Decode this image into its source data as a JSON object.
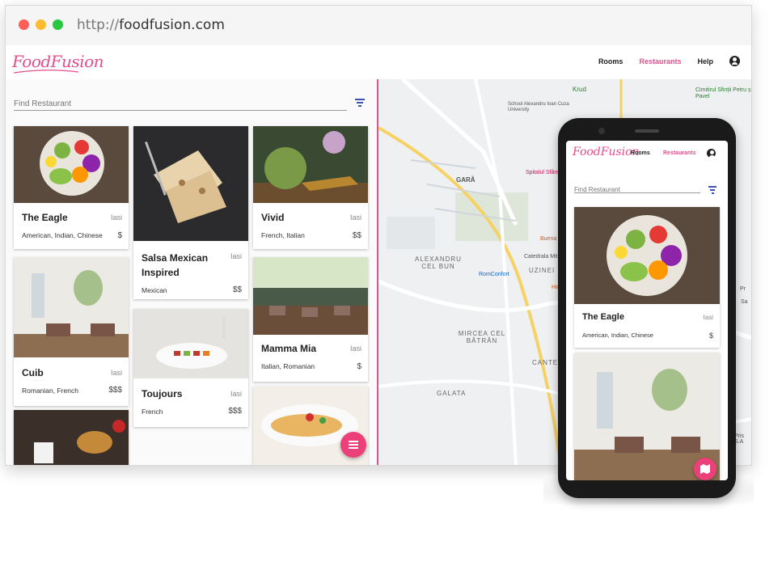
{
  "browser": {
    "url_protocol": "http://",
    "url_host": "foodfusion.com"
  },
  "app": {
    "logo_text": "FoodFusion",
    "nav": {
      "rooms": "Rooms",
      "restaurants": "Restaurants",
      "help": "Help"
    },
    "accent_color": "#e34f8c"
  },
  "search": {
    "placeholder": "Find Restaurant"
  },
  "restaurants": [
    {
      "name": "The Eagle",
      "city": "Iasi",
      "cuisine": "American, Indian, Chinese",
      "price": "$"
    },
    {
      "name": "Salsa Mexican Inspired",
      "city": "Iasi",
      "cuisine": "Mexican",
      "price": "$$"
    },
    {
      "name": "Vivid",
      "city": "Iasi",
      "cuisine": "French, Italian",
      "price": "$$"
    },
    {
      "name": "Cuib",
      "city": "Iasi",
      "cuisine": "Romanian, French",
      "price": "$$$"
    },
    {
      "name": "Toujours",
      "city": "Iasi",
      "cuisine": "French",
      "price": "$$$"
    },
    {
      "name": "Mamma Mia",
      "city": "Iasi",
      "cuisine": "Italian, Romanian",
      "price": "$"
    }
  ],
  "map_labels": {
    "krud": "Krud",
    "school": "School Alexandru Ioan Cuza University",
    "cimitir": "Cimitirul Sfinții Petru și Pavel",
    "gara": "GARĂ",
    "spitalul": "Spitalul Sfânt",
    "catedrala": "Catedrala Mitrop.",
    "uzinei": "UZINEI",
    "alexandru": "ALEXANDRU CEL BUN",
    "romconfort": "RomConfort",
    "mircea": "MIRCEA CEL BĂTRÂN",
    "cante": "CANTE",
    "galata": "GALATA",
    "buena": "Buena",
    "ha": "Ha",
    "pr": "Pr",
    "sa": "Sa",
    "prisa": "Pris S.A"
  },
  "phone": {
    "logo_text": "FoodFusion",
    "nav_rooms": "Rooms",
    "nav_restaurants": "Restaurants",
    "search_placeholder": "Find Restaurant",
    "card": {
      "name": "The Eagle",
      "city": "Iasi",
      "cuisine": "American, Indian, Chinese",
      "price": "$"
    }
  }
}
